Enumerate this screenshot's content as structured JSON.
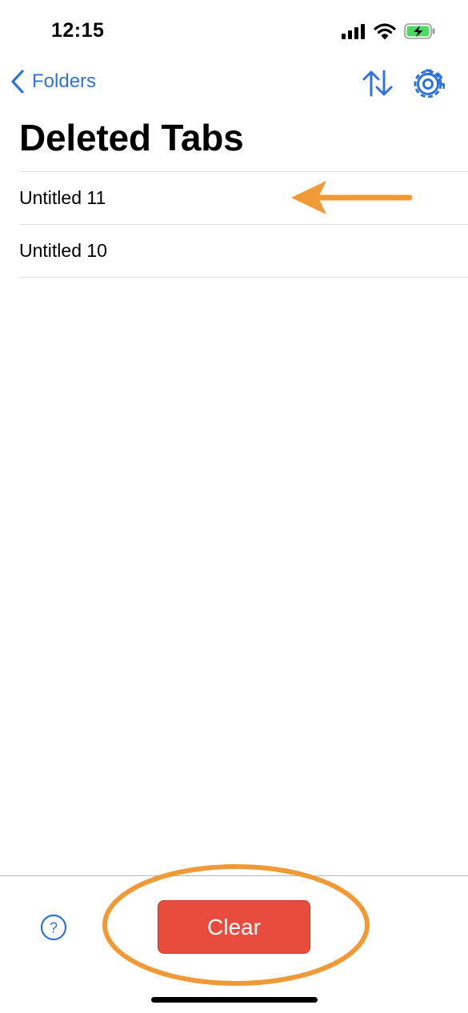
{
  "status_bar": {
    "time": "12:15",
    "icons": [
      "signal-icon",
      "wifi-icon",
      "battery-charging-icon"
    ],
    "battery_color": "#4cd964"
  },
  "nav": {
    "back_label": "Folders",
    "back_icon": "chevron-left-icon",
    "sort_icon": "sort-arrows-icon",
    "settings_icon": "gear-icon"
  },
  "page": {
    "title": "Deleted Tabs"
  },
  "tabs": [
    {
      "label": "Untitled 11"
    },
    {
      "label": "Untitled 10"
    }
  ],
  "toolbar": {
    "help_icon": "question-circle-icon",
    "clear_label": "Clear"
  },
  "colors": {
    "accent": "#2f73d9",
    "destructive": "#e84c3d",
    "annotation": "#f09a37"
  }
}
